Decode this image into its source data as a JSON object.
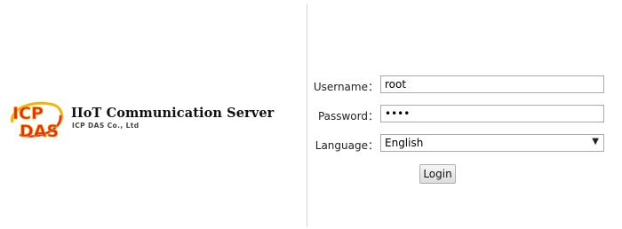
{
  "brand": {
    "logo_text_top": "ICP",
    "logo_text_bottom": "DAS",
    "product_title": "IIoT Communication Server",
    "company_name": "ICP DAS Co., Ltd",
    "logo_colors": {
      "fill": "#e8281c",
      "outline": "#f4b400"
    }
  },
  "login_form": {
    "username_label": "Username：",
    "username_value": "root",
    "password_label": "Password：",
    "password_value": "••••",
    "language_label": "Language：",
    "language_selected": "English",
    "login_button": "Login"
  }
}
